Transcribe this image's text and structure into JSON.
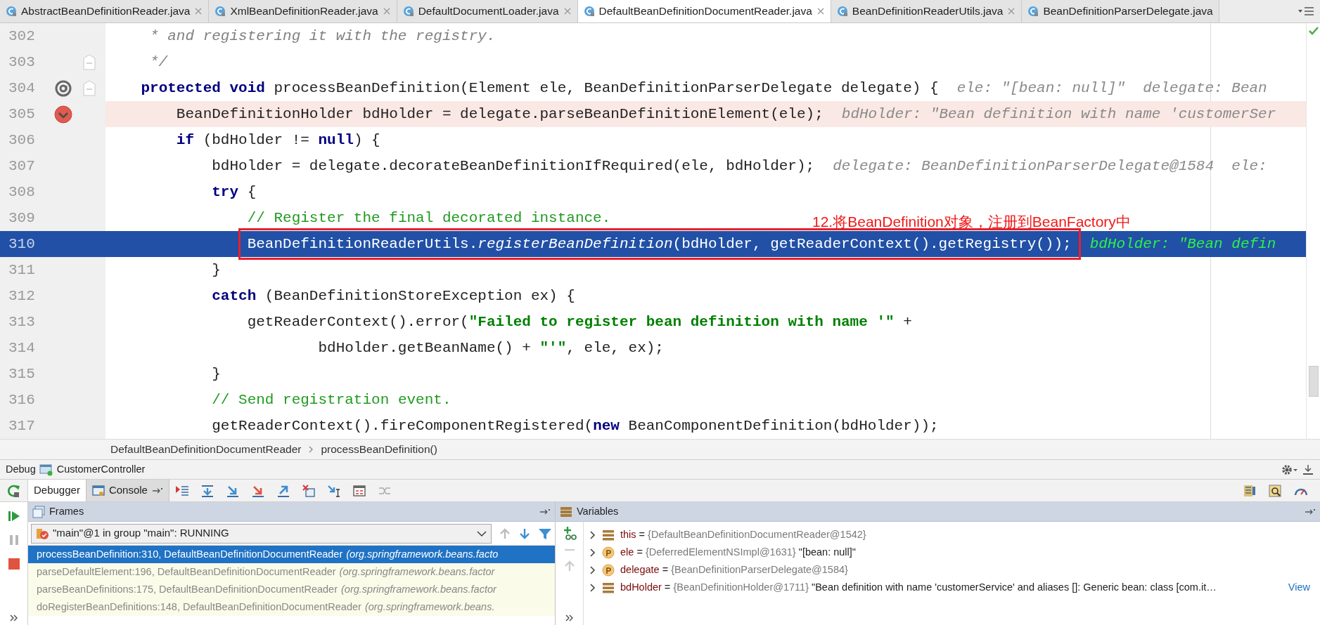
{
  "tabs": [
    {
      "label": "AbstractBeanDefinitionReader.java",
      "selected": false,
      "closable": true
    },
    {
      "label": "XmlBeanDefinitionReader.java",
      "selected": false,
      "closable": true
    },
    {
      "label": "DefaultDocumentLoader.java",
      "selected": false,
      "closable": true
    },
    {
      "label": "DefaultBeanDefinitionDocumentReader.java",
      "selected": true,
      "closable": true
    },
    {
      "label": "BeanDefinitionReaderUtils.java",
      "selected": false,
      "closable": true
    },
    {
      "label": "BeanDefinitionParserDelegate.java",
      "selected": false,
      "closable": false
    }
  ],
  "editor": {
    "lines": [
      {
        "number": "302",
        "breakpoint": false,
        "current": false,
        "foldable": false,
        "override": false,
        "tokens": [
          {
            "kind": "doc_comment",
            "text": "     * and registering it with the registry."
          }
        ]
      },
      {
        "number": "303",
        "breakpoint": false,
        "current": false,
        "foldable": true,
        "override": false,
        "tokens": [
          {
            "kind": "doc_comment",
            "text": "     */"
          }
        ]
      },
      {
        "number": "304",
        "breakpoint": false,
        "current": false,
        "foldable": true,
        "override": true,
        "tokens": [
          {
            "kind": "keyword",
            "text": "    protected void"
          },
          {
            "kind": "plain",
            "text": " processBeanDefinition(Element ele, BeanDefinitionParserDelegate delegate) {"
          }
        ],
        "hint": "ele: \"[bean: null]\"  delegate: Bean"
      },
      {
        "number": "305",
        "breakpoint": true,
        "current": false,
        "foldable": false,
        "override": false,
        "tokens": [
          {
            "kind": "plain",
            "text": "        BeanDefinitionHolder bdHolder = delegate.parseBeanDefinitionElement(ele);"
          }
        ],
        "hint": "bdHolder: \"Bean definition with name 'customerSer"
      },
      {
        "number": "306",
        "breakpoint": false,
        "current": false,
        "foldable": false,
        "override": false,
        "tokens": [
          {
            "kind": "keyword",
            "text": "        if"
          },
          {
            "kind": "plain",
            "text": " (bdHolder != "
          },
          {
            "kind": "keyword",
            "text": "null"
          },
          {
            "kind": "plain",
            "text": ") {"
          }
        ]
      },
      {
        "number": "307",
        "breakpoint": false,
        "current": false,
        "foldable": false,
        "override": false,
        "tokens": [
          {
            "kind": "plain",
            "text": "            bdHolder = delegate.decorateBeanDefinitionIfRequired(ele, bdHolder);"
          }
        ],
        "hint": "delegate: BeanDefinitionParserDelegate@1584  ele:"
      },
      {
        "number": "308",
        "breakpoint": false,
        "current": false,
        "foldable": false,
        "override": false,
        "tokens": [
          {
            "kind": "keyword",
            "text": "            try"
          },
          {
            "kind": "plain",
            "text": " {"
          }
        ]
      },
      {
        "number": "309",
        "breakpoint": false,
        "current": false,
        "foldable": false,
        "override": false,
        "tokens": [
          {
            "kind": "comment",
            "text": "                // Register the final decorated instance."
          }
        ]
      },
      {
        "number": "310",
        "breakpoint": false,
        "current": true,
        "foldable": false,
        "override": false,
        "annotation": "12.将BeanDefinition对象，注册到BeanFactory中",
        "tokens": [
          {
            "kind": "plain",
            "text": "                BeanDefinitionReaderUtils."
          },
          {
            "kind": "italic",
            "text": "registerBeanDefinition"
          },
          {
            "kind": "plain",
            "text": "(bdHolder, getReaderContext().getRegistry());"
          }
        ],
        "hint": "bdHolder: \"Bean defin"
      },
      {
        "number": "311",
        "breakpoint": false,
        "current": false,
        "foldable": false,
        "override": false,
        "tokens": [
          {
            "kind": "plain",
            "text": "            }"
          }
        ]
      },
      {
        "number": "312",
        "breakpoint": false,
        "current": false,
        "foldable": false,
        "override": false,
        "tokens": [
          {
            "kind": "keyword",
            "text": "            catch"
          },
          {
            "kind": "plain",
            "text": " (BeanDefinitionStoreException ex) {"
          }
        ]
      },
      {
        "number": "313",
        "breakpoint": false,
        "current": false,
        "foldable": false,
        "override": false,
        "tokens": [
          {
            "kind": "plain",
            "text": "                getReaderContext().error("
          },
          {
            "kind": "string",
            "text": "\"Failed to register bean definition with name '\""
          },
          {
            "kind": "plain",
            "text": " +"
          }
        ]
      },
      {
        "number": "314",
        "breakpoint": false,
        "current": false,
        "foldable": false,
        "override": false,
        "tokens": [
          {
            "kind": "plain",
            "text": "                        bdHolder.getBeanName() + "
          },
          {
            "kind": "string",
            "text": "\"'\""
          },
          {
            "kind": "plain",
            "text": ", ele, ex);"
          }
        ]
      },
      {
        "number": "315",
        "breakpoint": false,
        "current": false,
        "foldable": false,
        "override": false,
        "tokens": [
          {
            "kind": "plain",
            "text": "            }"
          }
        ]
      },
      {
        "number": "316",
        "breakpoint": false,
        "current": false,
        "foldable": false,
        "override": false,
        "tokens": [
          {
            "kind": "comment",
            "text": "            // Send registration event."
          }
        ]
      },
      {
        "number": "317",
        "breakpoint": false,
        "current": false,
        "foldable": false,
        "override": false,
        "tokens": [
          {
            "kind": "plain",
            "text": "            getReaderContext().fireComponentRegistered("
          },
          {
            "kind": "keyword",
            "text": "new"
          },
          {
            "kind": "plain",
            "text": " BeanComponentDefinition(bdHolder));"
          }
        ]
      }
    ]
  },
  "breadcrumb": [
    "DefaultBeanDefinitionDocumentReader",
    "processBeanDefinition()"
  ],
  "debug": {
    "title": "Debug",
    "configuration": "CustomerController",
    "tabs": [
      {
        "label": "Debugger",
        "selected": true
      },
      {
        "label": "Console",
        "selected": false
      }
    ],
    "frames": {
      "title": "Frames",
      "thread": "\"main\"@1 in group \"main\": RUNNING",
      "items": [
        {
          "method": "processBeanDefinition:310, DefaultBeanDefinitionDocumentReader",
          "package": "(org.springframework.beans.facto",
          "selected": true
        },
        {
          "method": "parseDefaultElement:196, DefaultBeanDefinitionDocumentReader",
          "package": "(org.springframework.beans.factor",
          "selected": false
        },
        {
          "method": "parseBeanDefinitions:175, DefaultBeanDefinitionDocumentReader",
          "package": "(org.springframework.beans.factor",
          "selected": false
        },
        {
          "method": "doRegisterBeanDefinitions:148, DefaultBeanDefinitionDocumentReader",
          "package": "(org.springframework.beans.",
          "selected": false
        }
      ]
    },
    "variables": {
      "title": "Variables",
      "items": [
        {
          "kind": "field",
          "name": "this",
          "operator": "=",
          "ref": "{DefaultBeanDefinitionDocumentReader@1542}"
        },
        {
          "kind": "param",
          "name": "ele",
          "operator": "=",
          "ref": "{DeferredElementNSImpl@1631}",
          "value": "\"[bean: null]\""
        },
        {
          "kind": "param",
          "name": "delegate",
          "operator": "=",
          "ref": "{BeanDefinitionParserDelegate@1584}"
        },
        {
          "kind": "field",
          "name": "bdHolder",
          "operator": "=",
          "ref": "{BeanDefinitionHolder@1711}",
          "value": "\"Bean definition with name 'customerService' and aliases []: Generic bean: class [com.it…",
          "link": "View"
        }
      ]
    }
  }
}
